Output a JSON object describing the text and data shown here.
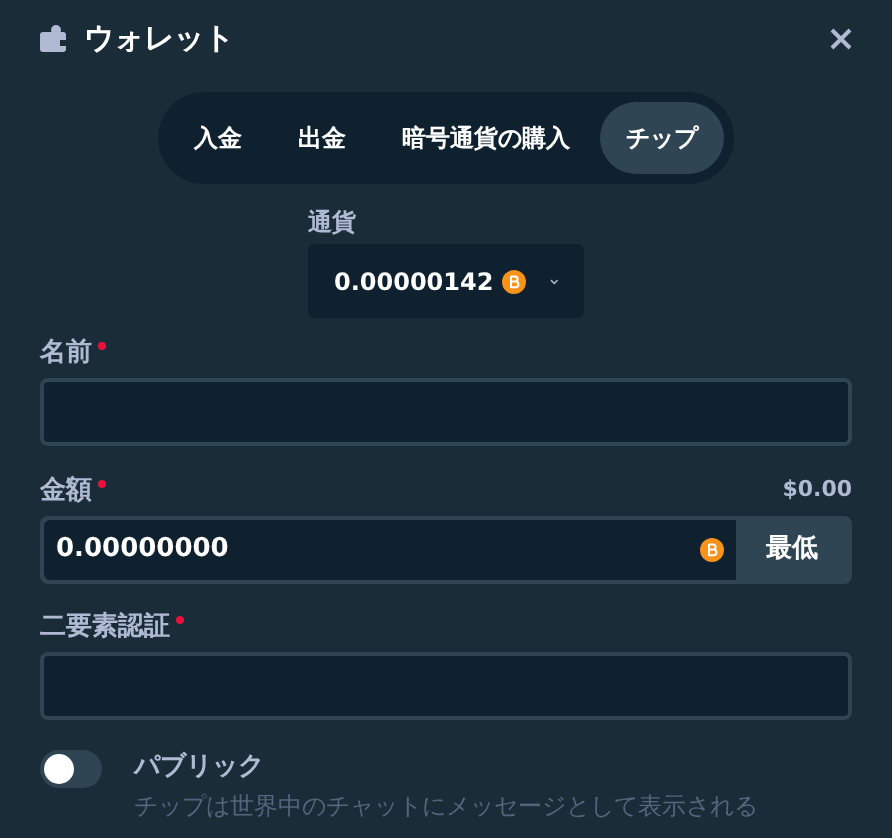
{
  "window": {
    "title": "ウォレット"
  },
  "tabs": [
    {
      "label": "入金",
      "selected": false
    },
    {
      "label": "出金",
      "selected": false
    },
    {
      "label": "暗号通貨の購入",
      "selected": false
    },
    {
      "label": "チップ",
      "selected": true
    }
  ],
  "currency": {
    "label": "通貨",
    "value": "0.00000142"
  },
  "fields": [
    {
      "kind": "text",
      "label": "名前",
      "required": true
    },
    {
      "kind": "amount",
      "label": "金額",
      "required": true,
      "usd": "$0.00",
      "value": "0.00000000",
      "button": "最低"
    },
    {
      "kind": "text",
      "label": "二要素認証",
      "required": true
    }
  ],
  "public": {
    "label": "パブリック",
    "on": false,
    "description": "チップは世界中のチャットにメッセージとして表示される"
  }
}
